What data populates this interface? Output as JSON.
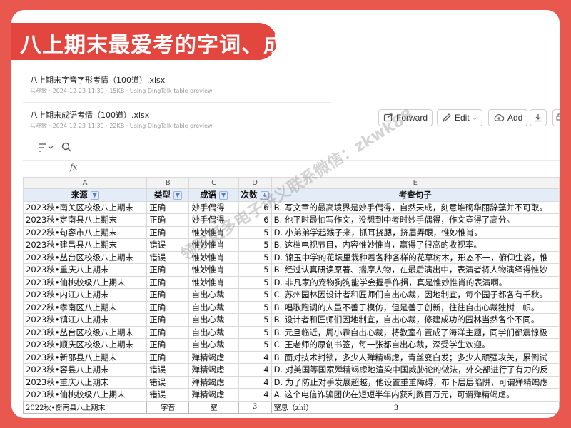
{
  "banner": {
    "title": "八上期末最爱考的字词、成语"
  },
  "files": [
    {
      "name": "八上期末字音字形考情（100道）.xlsx",
      "meta": "马晓敏 · 2024-12-23 11:39 · 15KB · Using DingTalk table preview"
    },
    {
      "name": "八上期末成语考情（100道）.xlsx",
      "meta": "马晓敏 · 2024-12-23 11:39 · 22KB · Using DingTalk table preview"
    }
  ],
  "toolbar": {
    "forward": "Forward",
    "edit": "Edit",
    "add": "Add",
    "fx": "fx"
  },
  "columns": [
    "A",
    "B",
    "C",
    "D",
    "E"
  ],
  "header": {
    "source": "来源",
    "type": "类型",
    "idiom": "成语",
    "count": "次数",
    "sentence": "考查句子"
  },
  "rows": [
    [
      "2023秋•南关区校级八上期末",
      "正确",
      "妙手偶得",
      "6",
      "B. 写文章的最高境界是妙手偶得，自然天成，刻意堆砌华丽辞藻并不可取。"
    ],
    [
      "2023秋•定南县八上期末",
      "正确",
      "妙手偶得",
      "6",
      "B. 他平时最怕写作文，没想到中考时妙手偶得，作文竟得了高分。"
    ],
    [
      "2022秋•句容市八上期末",
      "正确",
      "惟妙惟肖",
      "5",
      "D. 小弟弟学起猴子来，抓耳挠腮，挤眉弄眼，惟妙惟肖。"
    ],
    [
      "2023秋•建昌县八上期末",
      "错误",
      "惟妙惟肖",
      "5",
      "B. 这档电视节目，内容惟妙惟肖，赢得了很高的收视率。"
    ],
    [
      "2023秋•丛台区校级八上期末",
      "错误",
      "惟妙惟肖",
      "5",
      "D. 锦玉中学的花坛里栽种着各种各样的花草树木，形态不一，俯仰生姿，惟"
    ],
    [
      "2023秋•重庆八上期末",
      "正确",
      "惟妙惟肖",
      "5",
      "B. 经过认真研读原著、揣摩人物，在最后演出中，表演者将人物演绎得惟妙"
    ],
    [
      "2023秋•仙桃校级八上期末",
      "正确",
      "惟妙惟肖",
      "5",
      "D. 非凡家的宠物狗狗能学会握手作揖，真是惟妙惟肖的表演啊。"
    ],
    [
      "2023秋•内江八上期末",
      "正确",
      "自出心裁",
      "5",
      "C. 苏州园林因设计者和匠师们自出心裁，因地制宜，每个园子都各有千秋。"
    ],
    [
      "2022秋•孝南区八上期末",
      "正确",
      "自出心裁",
      "5",
      "B. 唱歌跑调的人虽不善于模仿，但是善于创新，往往自出心裁独树一帜。"
    ],
    [
      "2023秋•镇江八上期末",
      "正确",
      "自出心裁",
      "5",
      "B. 设计者和匠师们因地制宜，自出心裁，修建成功的园林当然各个不同。"
    ],
    [
      "2023秋•丛台区校级八上期末",
      "正确",
      "自出心裁",
      "5",
      "B. 元旦临近，周小霖自出心裁，将教室布置成了海洋主题，同学们都震惊极"
    ],
    [
      "2023秋•顺庆区校级八上期末",
      "正确",
      "自出心裁",
      "5",
      "C. 王老师的原创书签，每一张都自出心裁，深受学生欢迎。"
    ],
    [
      "2023秋•新邵县八上期末",
      "正确",
      "殚精竭虑",
      "4",
      "B. 面对技术封锁，多少人殚精竭虑，青丝变白发；多少人顽强攻关，累倒试"
    ],
    [
      "2023秋•容县八上期末",
      "错误",
      "殚精竭虑",
      "4",
      "D. 对美国等国家殚精竭虑地渲染中国威胁论的做法，外交部进行了有力的反"
    ],
    [
      "2023秋•重庆八上期末",
      "错误",
      "殚精竭虑",
      "4",
      "D. 为了防止对手发展超越，他设置重重障碍，布下层层陷阱，可谓殚精竭虑"
    ],
    [
      "2023秋•仙桃校级八上期末",
      "错误",
      "殚精竭虑",
      "4",
      "A. 这个电信诈骗团伙在短短半年内获利数百万元，可谓殚精竭虑。"
    ]
  ],
  "last_row": {
    "source": "2022秋•衡南县八上期末",
    "type": "字音",
    "word": "窒",
    "count": "3",
    "pinyin": "窒息（zhì）",
    "count2": "3"
  },
  "watermark": "领取更多电子讲义联系微信：zkwk88",
  "colors": {
    "background": "#e8584f",
    "banner": "#e2463f",
    "header_fill": "#e3ecf7"
  },
  "icons": [
    "sort-icon",
    "search-icon",
    "forward-icon",
    "edit-icon",
    "cloud-add-icon",
    "download-icon",
    "print-icon",
    "filter-icon",
    "sort-desc-icon"
  ]
}
